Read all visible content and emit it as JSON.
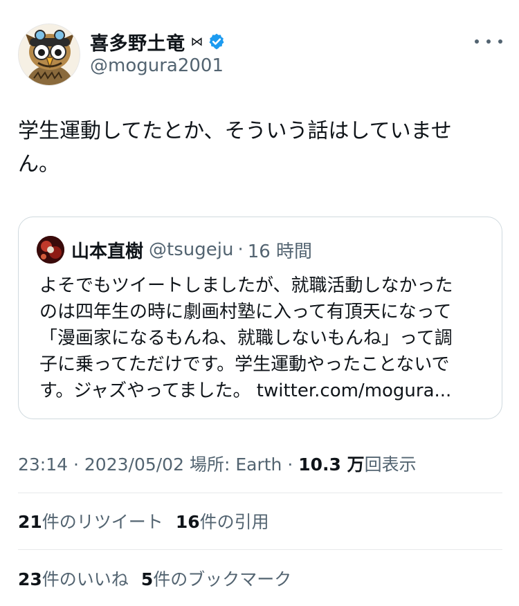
{
  "author": {
    "display_name": "喜多野土竜",
    "badge_symbol": "⋈",
    "handle": "@mogura2001",
    "verified_icon": "verified-badge-icon",
    "verified_color": "#1d9bf0"
  },
  "tweet": {
    "text_line1": "学生運動してたとか、そういう話はしていませ",
    "text_line2": "ん。"
  },
  "quote": {
    "name": "山本直樹",
    "handle": "@tsugeju",
    "separator": "·",
    "time": "16 時間",
    "lines": [
      "よそでもツイートしましたが、就職活動しなかった",
      "のは四年生の時に劇画村塾に入って有頂天になって",
      "「漫画家になるもんね、就職しないもんね」って調",
      "子に乗ってただけです。学生運動やったことないで",
      "す。ジャズやってました。 twitter.com/mogura..."
    ]
  },
  "meta": {
    "time": "23:14",
    "sep": "·",
    "date": "2023/05/02",
    "location": "場所: Earth",
    "views_number": "10.3 万",
    "views_label": "回表示"
  },
  "stats": {
    "retweets_count": "21",
    "retweets_label": "件のリツイート",
    "quotes_count": "16",
    "quotes_label": "件の引用",
    "likes_count": "23",
    "likes_label": "件のいいね",
    "bookmarks_count": "5",
    "bookmarks_label": "件のブックマーク"
  },
  "colors": {
    "text": "#0f1419",
    "secondary": "#536471",
    "border": "#cfd9de",
    "divider": "#e7e9ea"
  }
}
